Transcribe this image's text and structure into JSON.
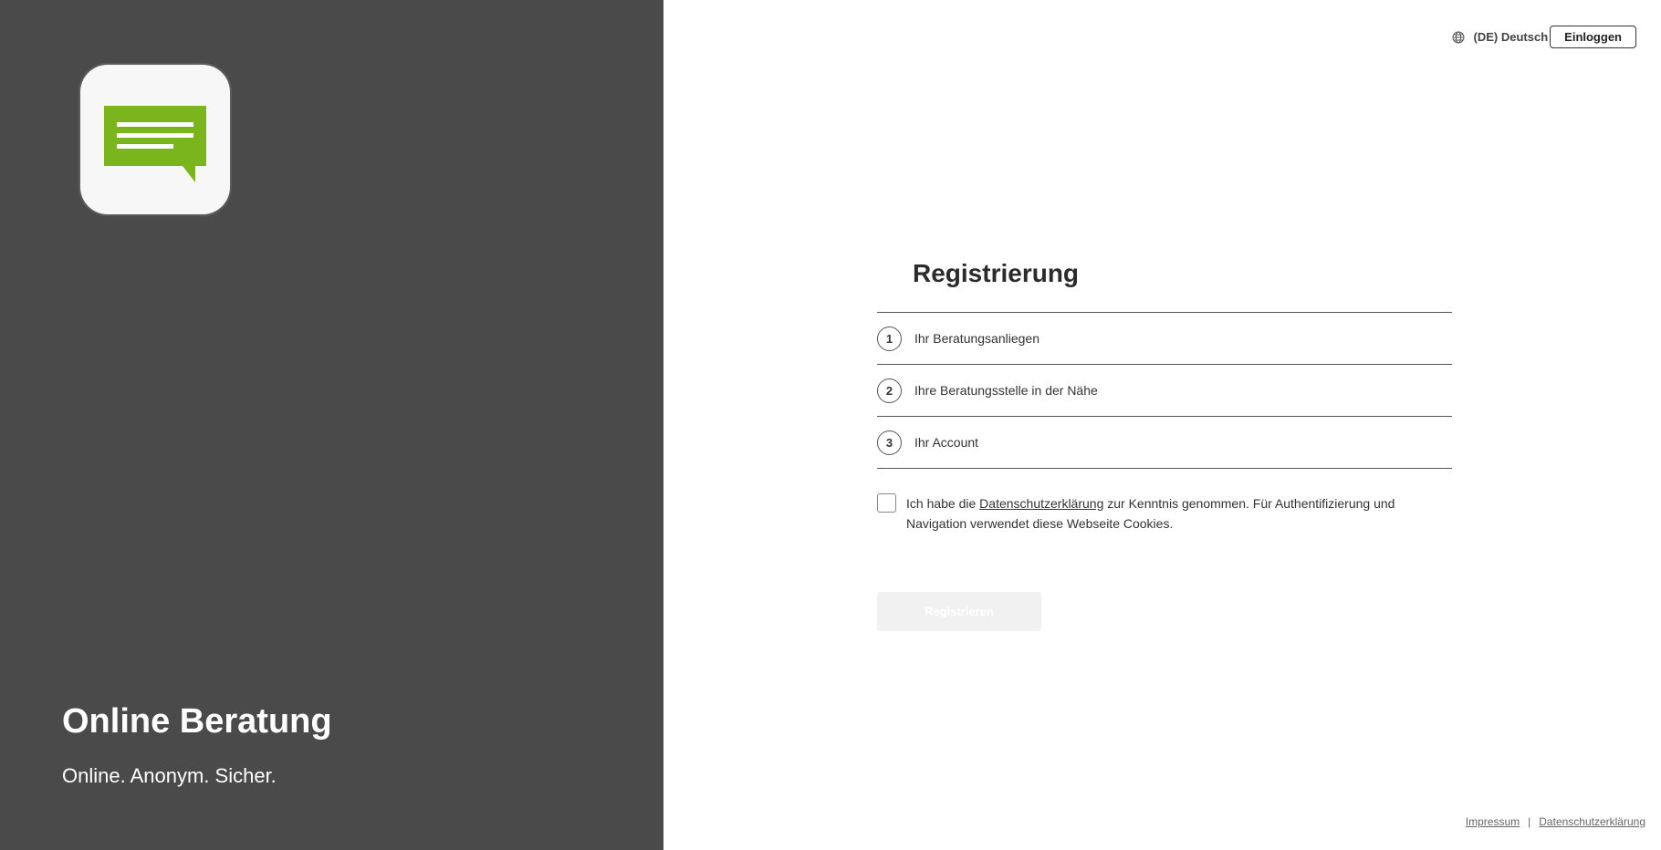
{
  "brand": {
    "title": "Online Beratung",
    "claim": "Online. Anonym. Sicher.",
    "logo_icon": "chat-message-icon",
    "logo_color": "#7ab51d"
  },
  "header": {
    "language_label": "(DE) Deutsch",
    "language_icon": "globe-icon",
    "login_label": "Einloggen"
  },
  "registration": {
    "title": "Registrierung",
    "steps": [
      {
        "number": "1",
        "label": "Ihr Beratungsanliegen"
      },
      {
        "number": "2",
        "label": "Ihre Beratungsstelle in der Nähe"
      },
      {
        "number": "3",
        "label": "Ihr Account"
      }
    ],
    "consent": {
      "checked": false,
      "text_before": "Ich habe die ",
      "link_label": "Datenschutzerklärung",
      "text_after": " zur Kenntnis genommen. Für Authentifizierung und Navigation verwendet diese Webseite Cookies."
    },
    "submit_label": "Registrieren",
    "submit_disabled": true
  },
  "footer": {
    "imprint_label": "Impressum",
    "separator": "|",
    "privacy_label": "Datenschutzerklärung"
  }
}
